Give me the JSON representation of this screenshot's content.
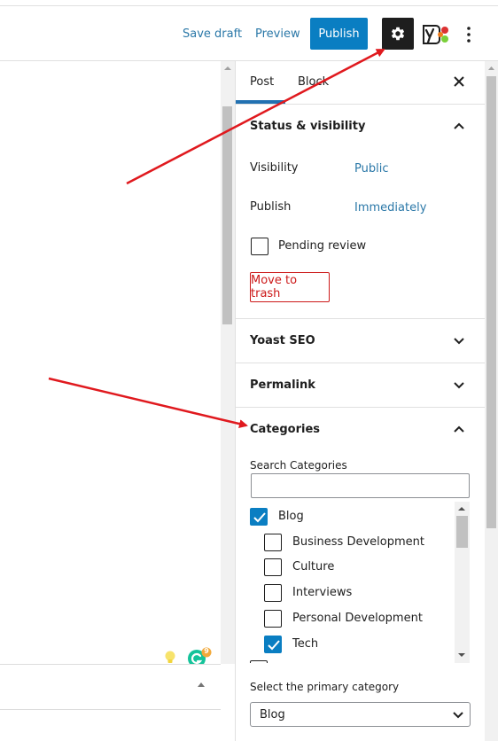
{
  "toolbar": {
    "save_draft": "Save draft",
    "preview": "Preview",
    "publish": "Publish"
  },
  "sidebar": {
    "tabs": [
      {
        "label": "Post",
        "active": true
      },
      {
        "label": "Block",
        "active": false
      }
    ],
    "status_visibility": {
      "title": "Status & visibility",
      "visibility_label": "Visibility",
      "visibility_value": "Public",
      "publish_label": "Publish",
      "publish_value": "Immediately",
      "pending_review_label": "Pending review",
      "pending_review_checked": false,
      "trash_label": "Move to trash"
    },
    "yoast": {
      "title": "Yoast SEO"
    },
    "permalink": {
      "title": "Permalink"
    },
    "categories": {
      "title": "Categories",
      "search_label": "Search Categories",
      "search_value": "",
      "items": [
        {
          "label": "Blog",
          "checked": true,
          "level": 0
        },
        {
          "label": "Business Development",
          "checked": false,
          "level": 1
        },
        {
          "label": "Culture",
          "checked": false,
          "level": 1
        },
        {
          "label": "Interviews",
          "checked": false,
          "level": 1
        },
        {
          "label": "Personal Development",
          "checked": false,
          "level": 1
        },
        {
          "label": "Tech",
          "checked": true,
          "level": 1
        }
      ],
      "primary_label": "Select the primary category",
      "primary_value": "Blog"
    }
  },
  "grammarly": {
    "badge_count": "9"
  },
  "colors": {
    "accent": "#0a7ec2",
    "link": "#2b78a8",
    "danger": "#cc1818",
    "annotation_arrow": "#e0191e"
  }
}
